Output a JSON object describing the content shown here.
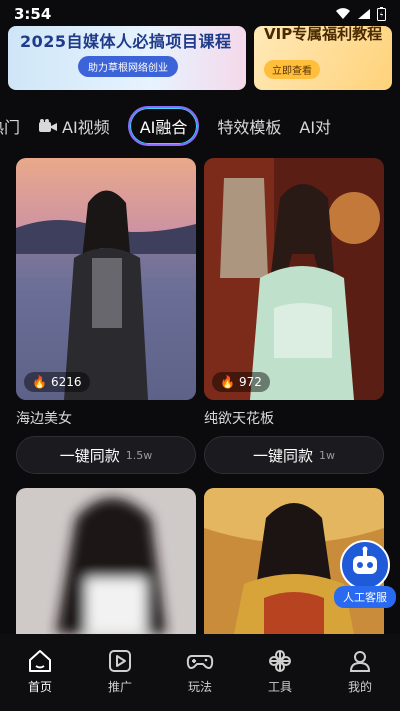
{
  "status": {
    "time": "3:54"
  },
  "banners": [
    {
      "title": "2025自媒体人必搞项目课程",
      "cta": "助力草根网络创业"
    },
    {
      "title": "VIP专属福利教程",
      "cta": "立即查看"
    }
  ],
  "tabs": [
    {
      "label": "热门",
      "icon": "fire-icon"
    },
    {
      "label": "AI视频",
      "icon": "video-camera-icon"
    },
    {
      "label": "AI融合",
      "icon": "",
      "active": true
    },
    {
      "label": "特效模板",
      "icon": ""
    },
    {
      "label": "AI对",
      "icon": ""
    }
  ],
  "cards": [
    {
      "name": "海边美女",
      "likes": "6216",
      "cta": "一键同款",
      "count": "1.5w"
    },
    {
      "name": "纯欲天花板",
      "likes": "972",
      "cta": "一键同款",
      "count": "1w"
    },
    {
      "name": "",
      "likes": "",
      "cta": "",
      "count": ""
    },
    {
      "name": "",
      "likes": "",
      "cta": "",
      "count": ""
    }
  ],
  "customer_service": {
    "label": "人工客服"
  },
  "nav": [
    {
      "label": "首页",
      "icon": "home-icon",
      "active": true
    },
    {
      "label": "推广",
      "icon": "play-square-icon"
    },
    {
      "label": "玩法",
      "icon": "gamepad-icon"
    },
    {
      "label": "工具",
      "icon": "tools-icon"
    },
    {
      "label": "我的",
      "icon": "user-icon"
    }
  ],
  "colors": {
    "accent": "#8a6cff",
    "accent2": "#3bd3ff",
    "bg": "#0b0b0d"
  }
}
